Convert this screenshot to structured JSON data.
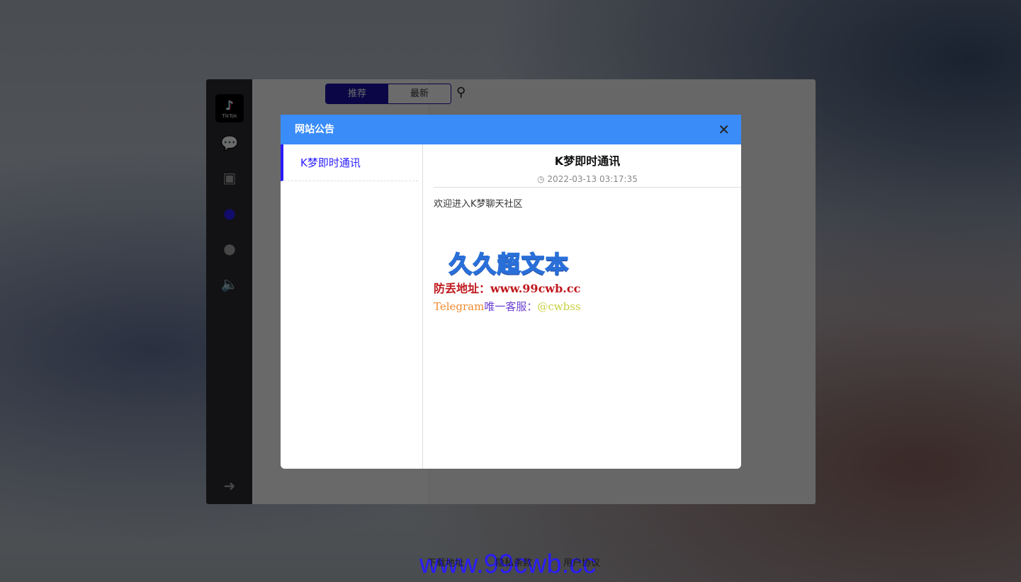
{
  "app": {
    "logo_text": "TikTok",
    "tabs": [
      "推荐",
      "最新"
    ],
    "nav_icons": [
      "comments-icon",
      "address-book-icon",
      "users-icon",
      "user-icon",
      "volume-icon"
    ],
    "logout_icon": "sign-out-icon",
    "active_color": "#1a10a8"
  },
  "footer": {
    "links": [
      "下载地址",
      "隐私条款",
      "用户协议"
    ],
    "watermark": "www.99cwb.cc"
  },
  "modal": {
    "title": "网站公告",
    "list": [
      {
        "label": "K梦即时通讯",
        "active": true
      }
    ],
    "detail": {
      "title": "K梦即时通讯",
      "date": "2022-03-13 03:17:35",
      "body": "欢迎进入K梦聊天社区",
      "banner": "久久超文本",
      "addr_label": "防丢地址：",
      "addr": "www.99cwb.cc",
      "tg_label": "Telegram",
      "tg_text": "唯一客服：",
      "tg_handle": "@cwbss"
    }
  },
  "colors": {
    "header": "#3a8cf8",
    "accent": "#2a1cff"
  }
}
